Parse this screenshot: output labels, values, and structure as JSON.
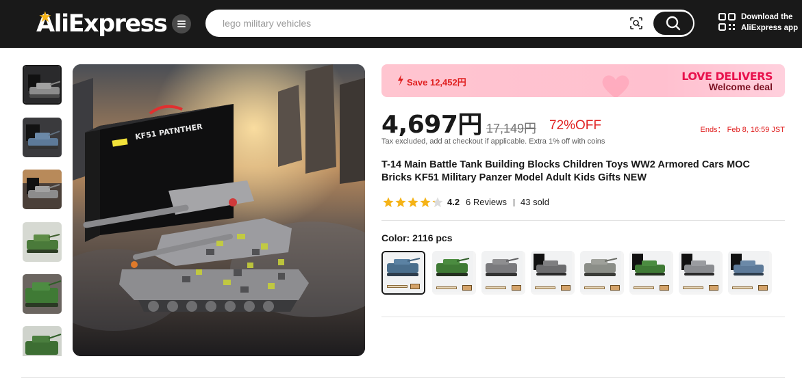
{
  "header": {
    "logo_text": "AliExpress",
    "search_query": "lego military vehicles",
    "app_line1": "Download the",
    "app_line2": "AliExpress app",
    "icons": [
      "menu-icon",
      "camera-search-icon",
      "search-icon",
      "qr-code-icon"
    ]
  },
  "gallery": {
    "thumbnails": [
      "thumb-1",
      "thumb-2",
      "thumb-3",
      "thumb-4",
      "thumb-5",
      "thumb-6"
    ],
    "selected_index": 0,
    "box_text": "KF51 PATNTHER"
  },
  "promo": {
    "save_text": "Save 12,452円",
    "title": "LOVE DELIVERS",
    "subtitle": "Welcome deal"
  },
  "price": {
    "current": "4,697円",
    "original": "17,149円",
    "discount": "72%OFF",
    "ends": "Ends：  Feb 8, 16:59 JST",
    "tax_note": "Tax excluded, add at checkout if applicable. Extra 1% off with coins"
  },
  "product": {
    "title": "T-14 Main Battle Tank Building Blocks Children Toys WW2 Armored Cars MOC Bricks KF51 Military Panzer Model Adult Kids Gifts NEW",
    "rating": 4.2,
    "rating_text": "4.2",
    "reviews": "6 Reviews",
    "sold": "43 sold"
  },
  "color": {
    "label": "Color:",
    "value": "2116 pcs",
    "option_count": 8,
    "selected_index": 0
  },
  "colors": {
    "header_bg": "#191919",
    "accent_red": "#e02020",
    "promo_pink": "#ffc5d0",
    "star": "#f5b317"
  }
}
